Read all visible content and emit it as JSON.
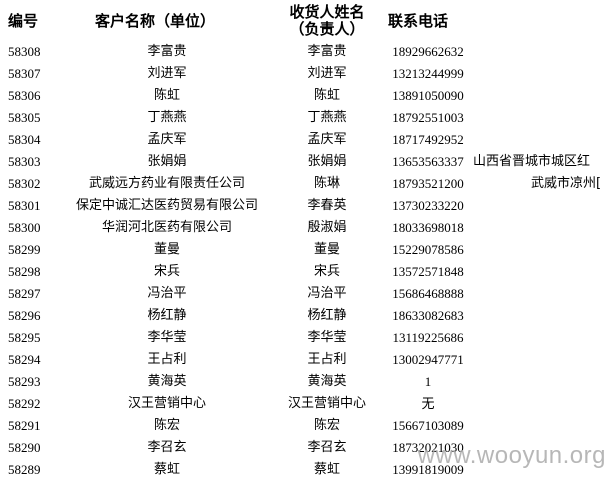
{
  "header": {
    "id": "编号",
    "customer": "客户名称（单位）",
    "receiver_line1": "收货人姓名",
    "receiver_line2": "（负责人）",
    "phone": "联系电话"
  },
  "rows": [
    {
      "id": "58308",
      "customer": "李富贵",
      "receiver": "李富贵",
      "phone": "18929662632",
      "address": ""
    },
    {
      "id": "58307",
      "customer": "刘进军",
      "receiver": "刘进军",
      "phone": "13213244999",
      "address": ""
    },
    {
      "id": "58306",
      "customer": "陈虹",
      "receiver": "陈虹",
      "phone": "13891050090",
      "address": ""
    },
    {
      "id": "58305",
      "customer": "丁燕燕",
      "receiver": "丁燕燕",
      "phone": "18792551003",
      "address": ""
    },
    {
      "id": "58304",
      "customer": "孟庆军",
      "receiver": "孟庆军",
      "phone": "18717492952",
      "address": ""
    },
    {
      "id": "58303",
      "customer": "张娟娟",
      "receiver": "张娟娟",
      "phone": "13653563337",
      "address": "山西省晋城市城区红"
    },
    {
      "id": "58302",
      "customer": "武威远方药业有限责任公司",
      "receiver": "陈琳",
      "phone": "18793521200",
      "address": "武威市凉州[",
      "indent": true
    },
    {
      "id": "58301",
      "customer": "保定中诚汇达医药贸易有限公司",
      "receiver": "李春英",
      "phone": "13730233220",
      "address": ""
    },
    {
      "id": "58300",
      "customer": "华润河北医药有限公司",
      "receiver": "殷淑娟",
      "phone": "18033698018",
      "address": ""
    },
    {
      "id": "58299",
      "customer": "董曼",
      "receiver": "董曼",
      "phone": "15229078586",
      "address": ""
    },
    {
      "id": "58298",
      "customer": "宋兵",
      "receiver": "宋兵",
      "phone": "13572571848",
      "address": ""
    },
    {
      "id": "58297",
      "customer": "冯治平",
      "receiver": "冯治平",
      "phone": "15686468888",
      "address": ""
    },
    {
      "id": "58296",
      "customer": "杨红静",
      "receiver": "杨红静",
      "phone": "18633082683",
      "address": ""
    },
    {
      "id": "58295",
      "customer": "李华莹",
      "receiver": "李华莹",
      "phone": "13119225686",
      "address": ""
    },
    {
      "id": "58294",
      "customer": "王占利",
      "receiver": "王占利",
      "phone": "13002947771",
      "address": ""
    },
    {
      "id": "58293",
      "customer": "黄海英",
      "receiver": "黄海英",
      "phone": "1",
      "address": ""
    },
    {
      "id": "58292",
      "customer": "汉王营销中心",
      "receiver": "汉王营销中心",
      "phone": "无",
      "address": ""
    },
    {
      "id": "58291",
      "customer": "陈宏",
      "receiver": "陈宏",
      "phone": "15667103089",
      "address": ""
    },
    {
      "id": "58290",
      "customer": "李召玄",
      "receiver": "李召玄",
      "phone": "18732021030",
      "address": ""
    },
    {
      "id": "58289",
      "customer": "蔡虹",
      "receiver": "蔡虹",
      "phone": "13991819009",
      "address": ""
    }
  ],
  "watermark": "www.wooyun.org"
}
